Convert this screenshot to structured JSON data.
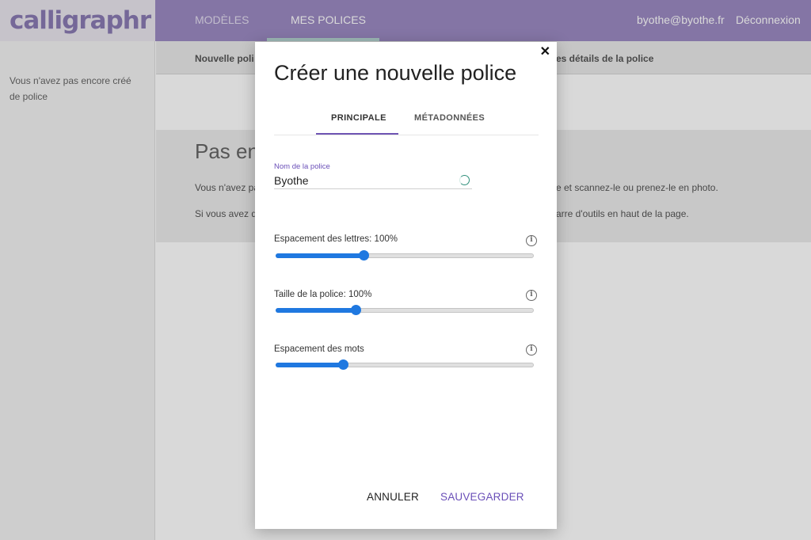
{
  "brand": {
    "logo_text": "calligraphr"
  },
  "topnav": {
    "items": [
      {
        "label": "MODÈLES"
      },
      {
        "label": "MES POLICES"
      }
    ],
    "user_email": "byothe@byothe.fr",
    "logout_label": "Déconnexion"
  },
  "sidebar": {
    "empty_text": "Vous n'avez pas encore créé de police"
  },
  "content": {
    "subbar_left": "Nouvelle poli",
    "subbar_right": "es détails de la police",
    "empty_title": "Pas en",
    "empty_p1": "Vous n'avez pa",
    "empty_p2": "Si vous avez de",
    "empty_r1": "e et scannez-le ou prenez-le en photo.",
    "empty_r2": "arre d'outils en haut de la page."
  },
  "modal": {
    "close_symbol": "✕",
    "title": "Créer une nouvelle police",
    "tabs": [
      {
        "label": "PRINCIPALE"
      },
      {
        "label": "MÉTADONNÉES"
      }
    ],
    "font_name": {
      "label": "Nom de la police",
      "value": "Byothe"
    },
    "sliders": [
      {
        "label": "Espacement des lettres: 100%",
        "value": 0.34
      },
      {
        "label": "Taille de la police: 100%",
        "value": 0.31
      },
      {
        "label": "Espacement des mots",
        "value": 0.26
      }
    ],
    "info_symbol": "i",
    "cancel_label": "ANNULER",
    "save_label": "SAUVEGARDER"
  },
  "colors": {
    "topbar": "#9c8ac2",
    "accent": "#6a4fb8",
    "slider": "#1f78e0"
  }
}
